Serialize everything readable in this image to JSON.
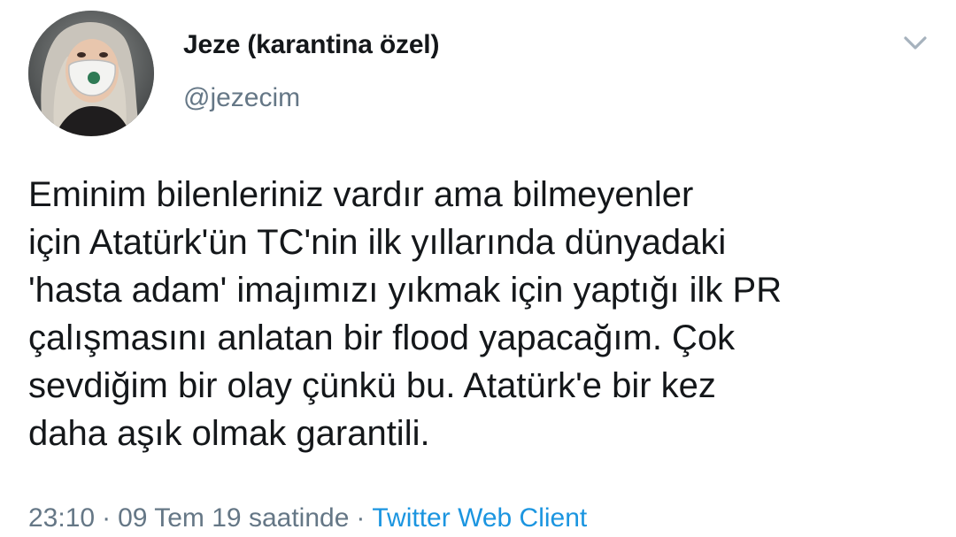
{
  "tweet": {
    "author": {
      "display_name": "Jeze (karantina özel)",
      "handle": "@jezecim"
    },
    "menu_icon": "chevron-down-icon",
    "text_lines": [
      "Eminim bilenleriniz vardır ama bilmeyenler",
      "için Atatürk'ün TC'nin ilk yıllarında dünyadaki",
      "'hasta adam' imajımızı yıkmak için yaptığı ilk PR",
      "çalışmasını anlatan bir flood yapacağım. Çok",
      "sevdiğim bir olay çünkü bu. Atatürk'e bir kez",
      "daha aşık olmak garantili."
    ],
    "time": "23:10",
    "separator": "·",
    "date": "09 Tem 19 saatinde",
    "client": "Twitter Web Client"
  },
  "colors": {
    "text": "#14171a",
    "secondary": "#657786",
    "link": "#1b95e0"
  }
}
